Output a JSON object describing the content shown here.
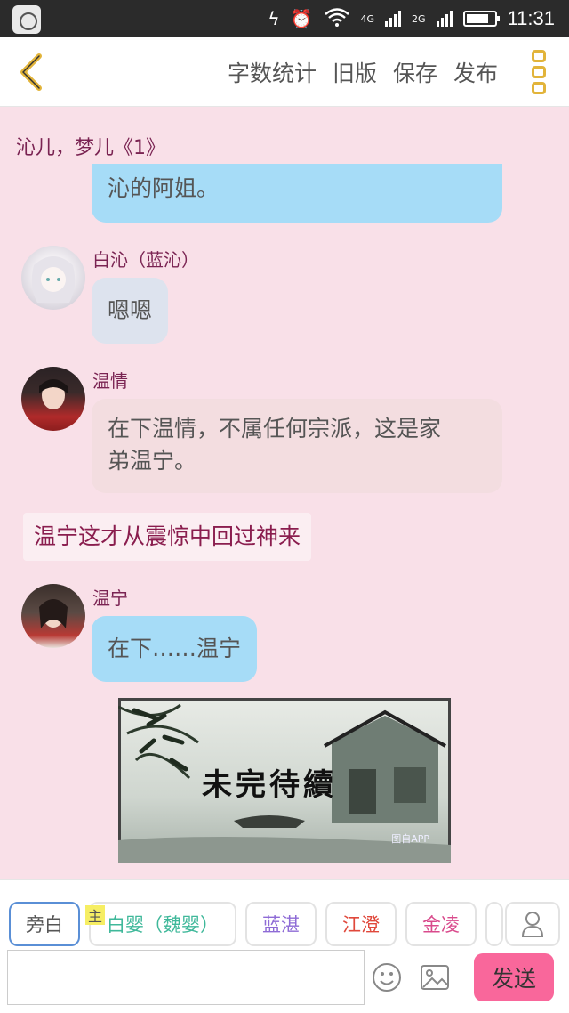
{
  "status_bar": {
    "network_1": "4G",
    "network_2": "2G",
    "time": "11:31"
  },
  "toolbar": {
    "actions": [
      "字数统计",
      "旧版",
      "保存",
      "发布"
    ]
  },
  "chat": {
    "chapter_title": "沁儿，梦儿《1》",
    "messages": [
      {
        "type": "bubble",
        "text": "沁的阿姐。"
      },
      {
        "type": "dialog",
        "speaker": "白沁（蓝沁）",
        "text": "嗯嗯"
      },
      {
        "type": "dialog",
        "speaker": "温情",
        "text_line1": "在下温情，不属任何宗派，这是家",
        "text_line2": "弟温宁。"
      },
      {
        "type": "narration",
        "text": "温宁这才从震惊中回过神来"
      },
      {
        "type": "dialog",
        "speaker": "温宁",
        "text": "在下……温宁"
      }
    ],
    "end_image": {
      "text": "未完待續",
      "watermark": "图自APP"
    }
  },
  "bottom_bar": {
    "roles": [
      "旁白",
      "白婴（魏婴）",
      "蓝湛",
      "江澄",
      "金凌"
    ],
    "main_tag": "主",
    "role_colors": [
      "#555555",
      "#3fb89a",
      "#8e6bd6",
      "#e0483b",
      "#d94a8c"
    ],
    "input_placeholder": "",
    "send_label": "发送",
    "send_color": "#f9679b"
  }
}
